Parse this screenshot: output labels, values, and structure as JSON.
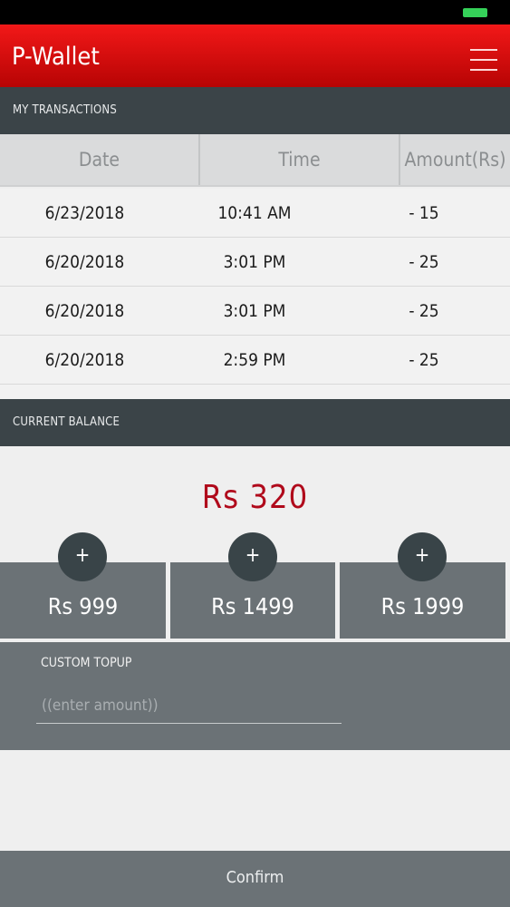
{
  "app": {
    "title": "P-Wallet",
    "brand_color": "#e10c0c"
  },
  "header": {
    "menu_icon": "hamburger-menu-icon"
  },
  "transactions": {
    "section_title": "MY TRANSACTIONS",
    "columns": [
      "Date",
      "Time",
      "Amount(Rs)"
    ],
    "rows": [
      {
        "date": "6/23/2018",
        "time": "10:41 AM",
        "amount": "- 15"
      },
      {
        "date": "6/20/2018",
        "time": "3:01 PM",
        "amount": "- 25"
      },
      {
        "date": "6/20/2018",
        "time": "3:01 PM",
        "amount": "- 25"
      },
      {
        "date": "6/20/2018",
        "time": "2:59 PM",
        "amount": "- 25"
      }
    ]
  },
  "balance": {
    "section_title": "CURRENT BALANCE",
    "value": "Rs 320"
  },
  "topups": {
    "plus_label": "+",
    "options": [
      {
        "amount": "Rs 999"
      },
      {
        "amount": "Rs 1499"
      },
      {
        "amount": "Rs 1999"
      }
    ]
  },
  "custom_topup": {
    "label": "CUSTOM TOPUP",
    "placeholder": "((enter amount))",
    "value": ""
  },
  "confirm": {
    "label": "Confirm"
  }
}
